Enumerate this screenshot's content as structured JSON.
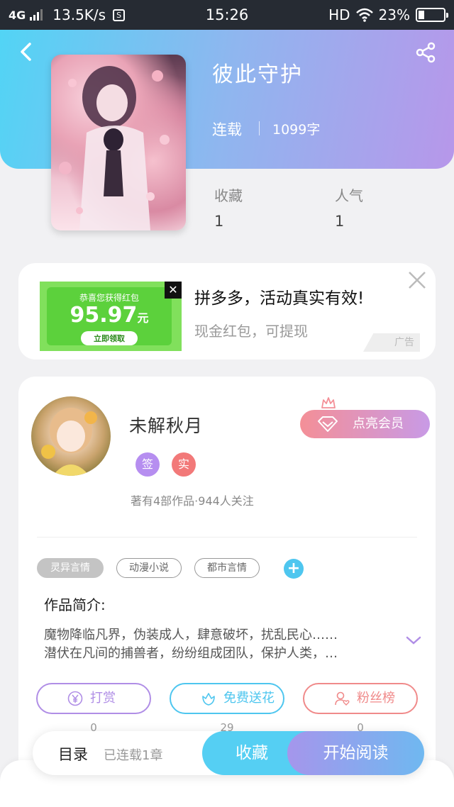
{
  "status_bar": {
    "network": "4G",
    "speed": "13.5K/s",
    "s_icon": "S",
    "time": "15:26",
    "hd": "HD",
    "battery": "23%"
  },
  "book": {
    "title": "彼此守护",
    "status": "连载",
    "words": "1099字",
    "favorites_label": "收藏",
    "favorites_value": "1",
    "popularity_label": "人气",
    "popularity_value": "1"
  },
  "ad": {
    "banner_line": "恭喜您获得红包",
    "amount": "95.97",
    "unit": "元",
    "claim": "立即领取",
    "title": "拼多多，活动真实有效!",
    "subtitle": "现金红包，可提现",
    "tag": "广告"
  },
  "author": {
    "name": "未解秋月",
    "badge_sign": "签",
    "badge_real": "实",
    "meta": "著有4部作品·944人关注",
    "vip_label": "点亮会员"
  },
  "tags": [
    "灵异言情",
    "动漫小说",
    "都市言情"
  ],
  "tag_add": "+",
  "intro": {
    "title": "作品简介:",
    "line1": "魔物降临凡界，伪装成人，肆意破坏，扰乱民心……",
    "line2": "潜伏在凡间的捕兽者，纷纷组成团队，保护人类，…"
  },
  "actions": {
    "reward_label": "打赏",
    "reward_count": "0",
    "flower_label": "免费送花",
    "flower_count": "29",
    "fans_label": "粉丝榜",
    "fans_count": "0"
  },
  "bottom": {
    "toc": "目录",
    "toc_sub": "已连载1章",
    "collect": "收藏",
    "read": "开始阅读"
  },
  "colors": {
    "header_start": "#52d4f5",
    "header_end": "#b797ea",
    "badge_sign": "#b68ef0",
    "badge_real": "#f27979",
    "reward": "#b08ee6",
    "flower": "#4ec6ef",
    "fans": "#f08a8a"
  }
}
